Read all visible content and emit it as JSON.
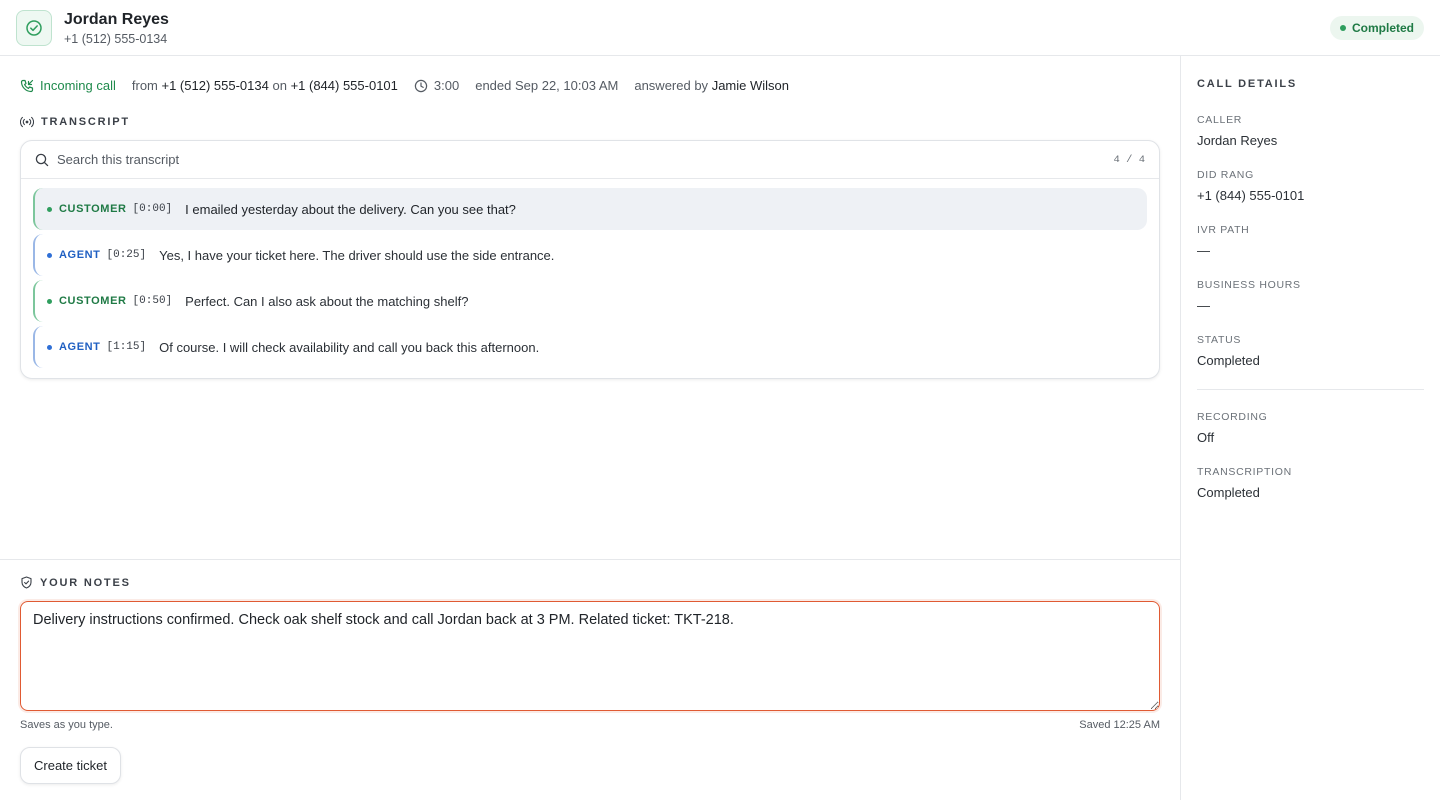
{
  "header": {
    "name": "Jordan Reyes",
    "phone": "+1 (512) 555-0134",
    "status": "Completed"
  },
  "meta": {
    "direction": "Incoming call",
    "from_prefix": "from",
    "from_number": "+1 (512) 555-0134",
    "on_word": "on",
    "to_number": "+1 (844) 555-0101",
    "duration": "3:00",
    "ended": "ended Sep 22, 10:03 AM",
    "answered_prefix": "answered by",
    "answered_by": "Jamie Wilson"
  },
  "transcript": {
    "label": "TRANSCRIPT",
    "search_placeholder": "Search this transcript",
    "count": "4 / 4",
    "messages": [
      {
        "role": "CUSTOMER",
        "ts": "[0:00]",
        "text": "I emailed yesterday about the delivery. Can you see that?"
      },
      {
        "role": "AGENT",
        "ts": "[0:25]",
        "text": "Yes, I have your ticket here. The driver should use the side entrance."
      },
      {
        "role": "CUSTOMER",
        "ts": "[0:50]",
        "text": "Perfect. Can I also ask about the matching shelf?"
      },
      {
        "role": "AGENT",
        "ts": "[1:15]",
        "text": "Of course. I will check availability and call you back this afternoon."
      }
    ]
  },
  "notes": {
    "label": "YOUR NOTES",
    "value": "Delivery instructions confirmed. Check oak shelf stock and call Jordan back at 3 PM. Related ticket: TKT-218.",
    "hint": "Saves as you type.",
    "saved": "Saved 12:25 AM",
    "create_label": "Create ticket"
  },
  "details": {
    "title": "CALL DETAILS",
    "caller_label": "CALLER",
    "caller": "Jordan Reyes",
    "did_label": "DID RANG",
    "did": "+1 (844) 555-0101",
    "ivr_label": "IVR PATH",
    "ivr": "—",
    "hours_label": "BUSINESS HOURS",
    "hours": "—",
    "status_label": "STATUS",
    "status": "Completed",
    "recording_label": "RECORDING",
    "recording": "Off",
    "transcription_label": "TRANSCRIPTION",
    "transcription": "Completed"
  },
  "colors": {
    "accent_green": "#1f8a4c",
    "agent_blue": "#1f5fc2",
    "notes_border": "#e05a33"
  }
}
